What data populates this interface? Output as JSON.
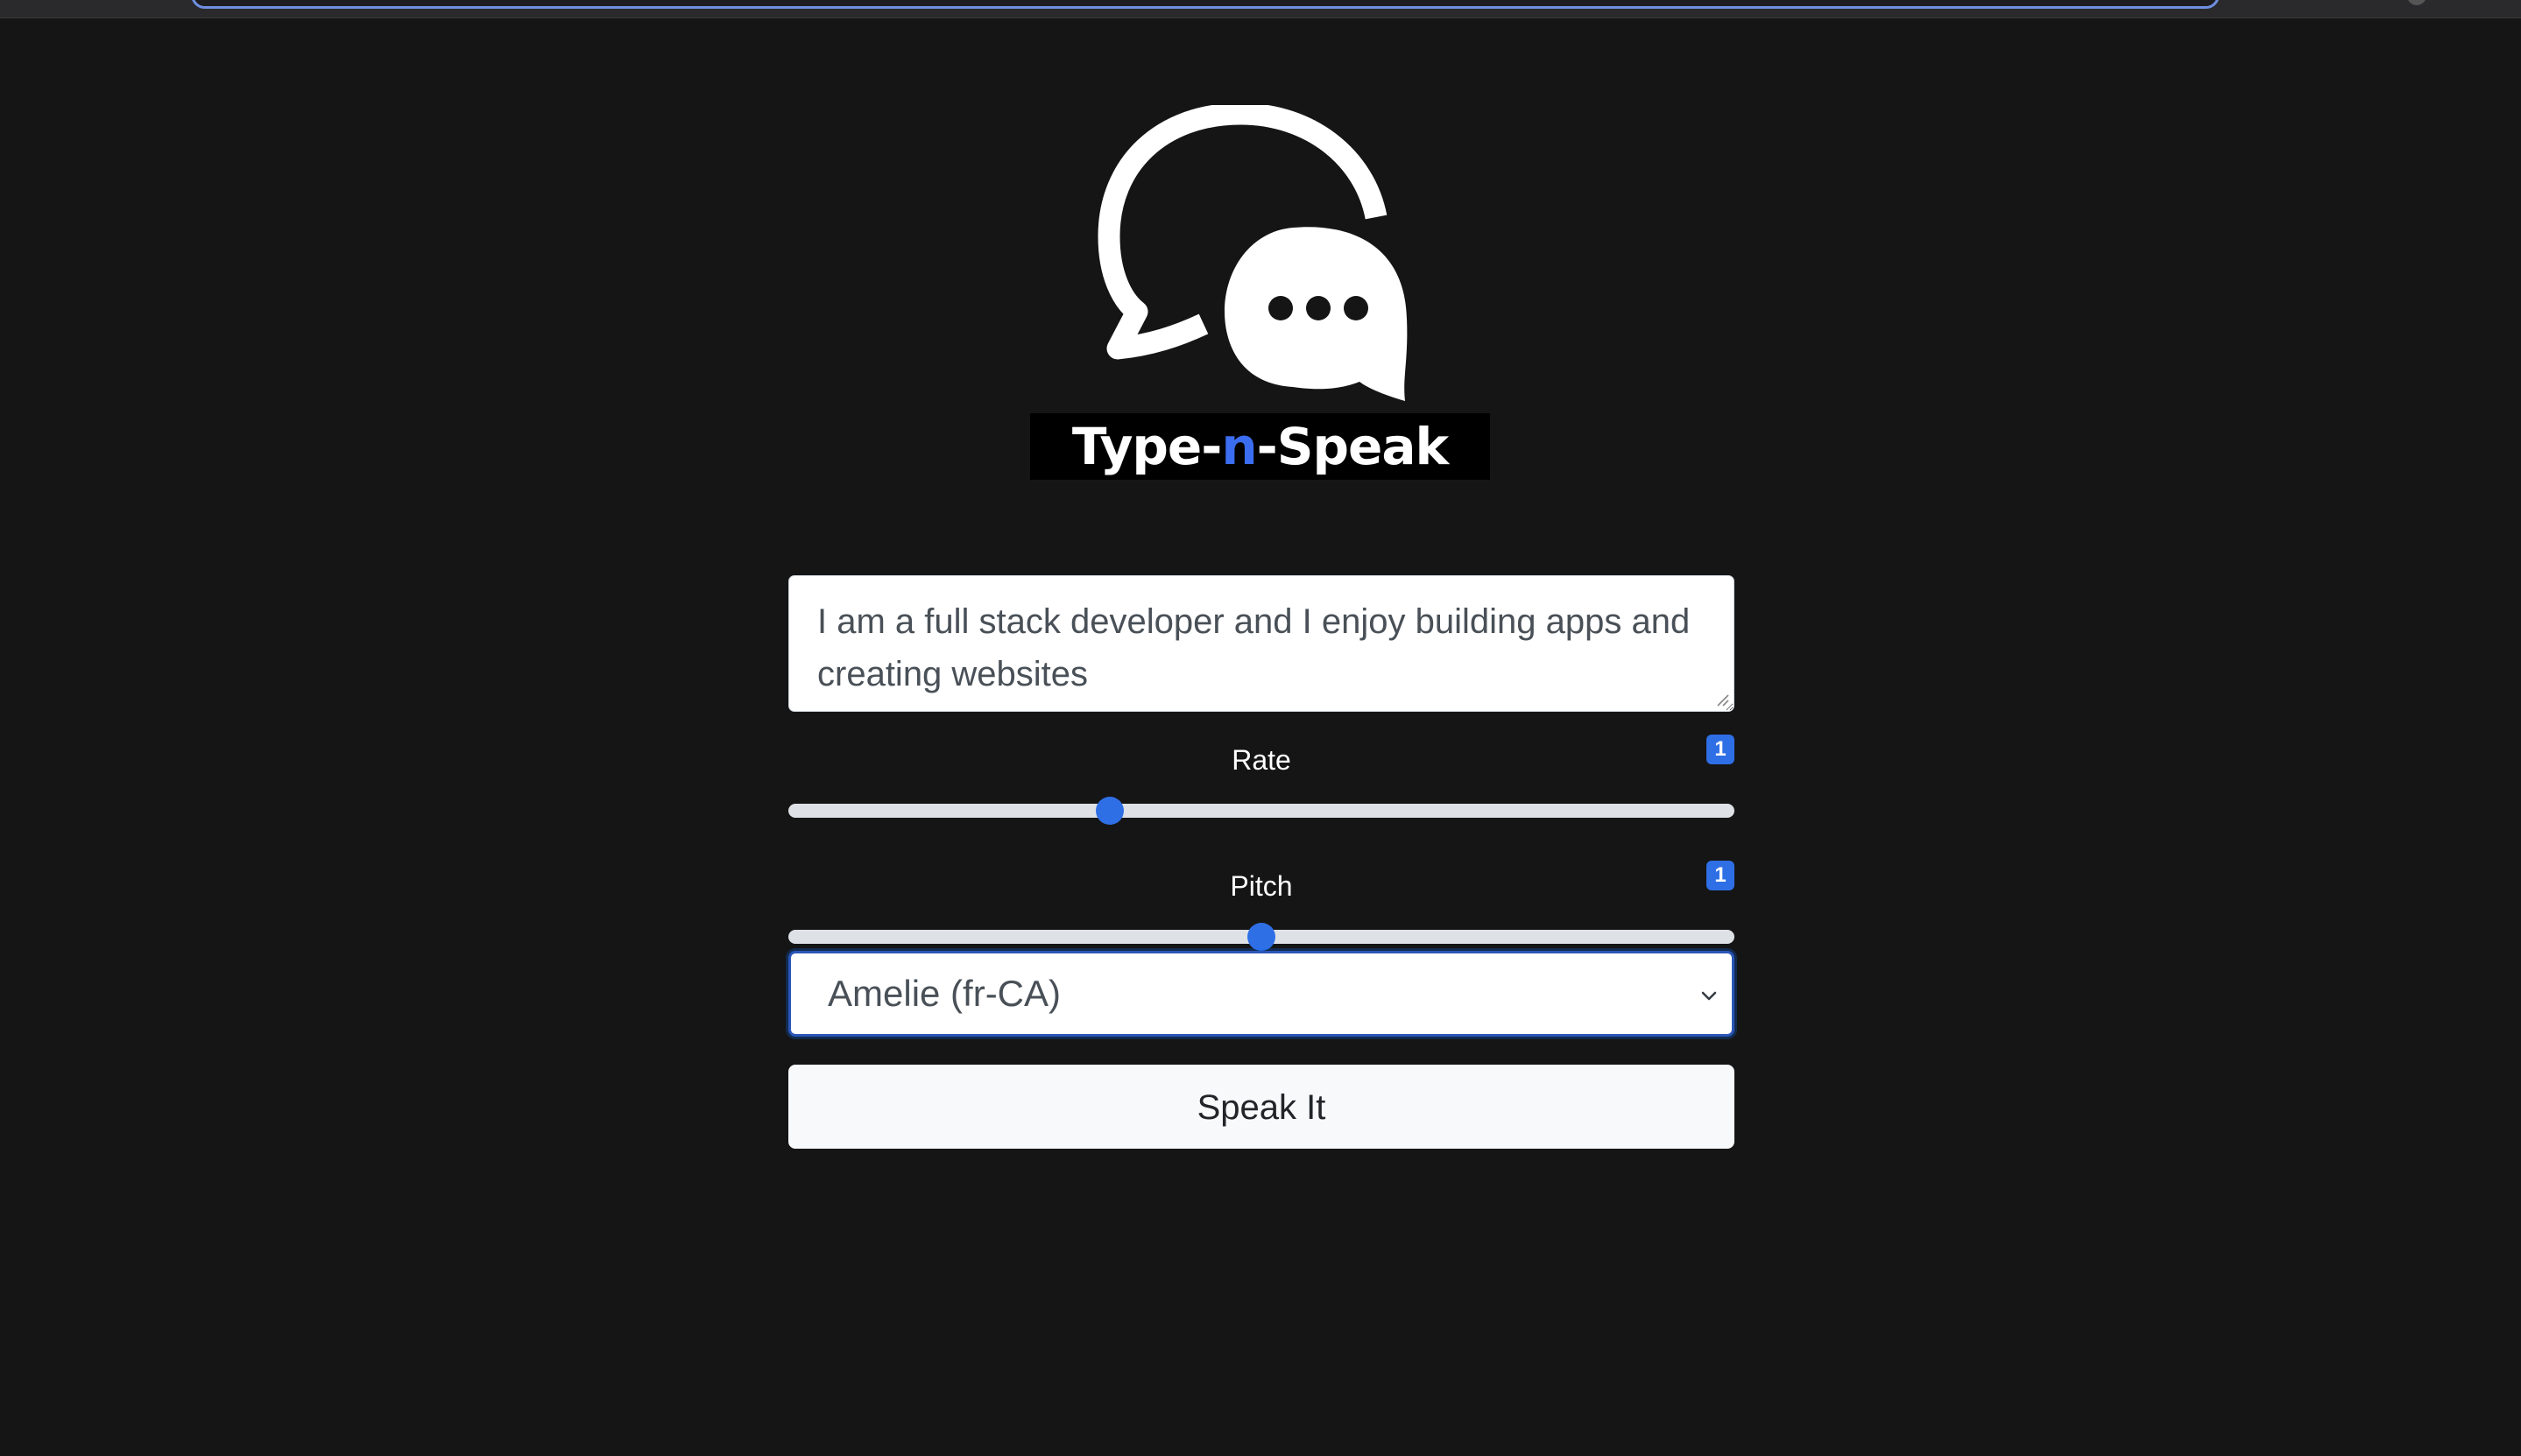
{
  "app": {
    "logo_text_prefix": "Type-",
    "logo_text_accent": "n",
    "logo_text_suffix": "-Speak",
    "accent_color": "#3b6df0",
    "background_color": "#151515"
  },
  "form": {
    "text_input_value": "I am a full stack developer and I enjoy building apps and creating websites",
    "rate": {
      "label": "Rate",
      "badge_value": "1",
      "slider_fraction": 0.34
    },
    "pitch": {
      "label": "Pitch",
      "badge_value": "1",
      "slider_fraction": 0.5
    },
    "voice_select": {
      "selected": "Amelie (fr-CA)"
    },
    "speak_button_label": "Speak It"
  },
  "icons": {
    "logo": "chat-bubbles-icon",
    "select_arrow": "chevron-down-icon",
    "resize": "resize-grip-icon"
  }
}
